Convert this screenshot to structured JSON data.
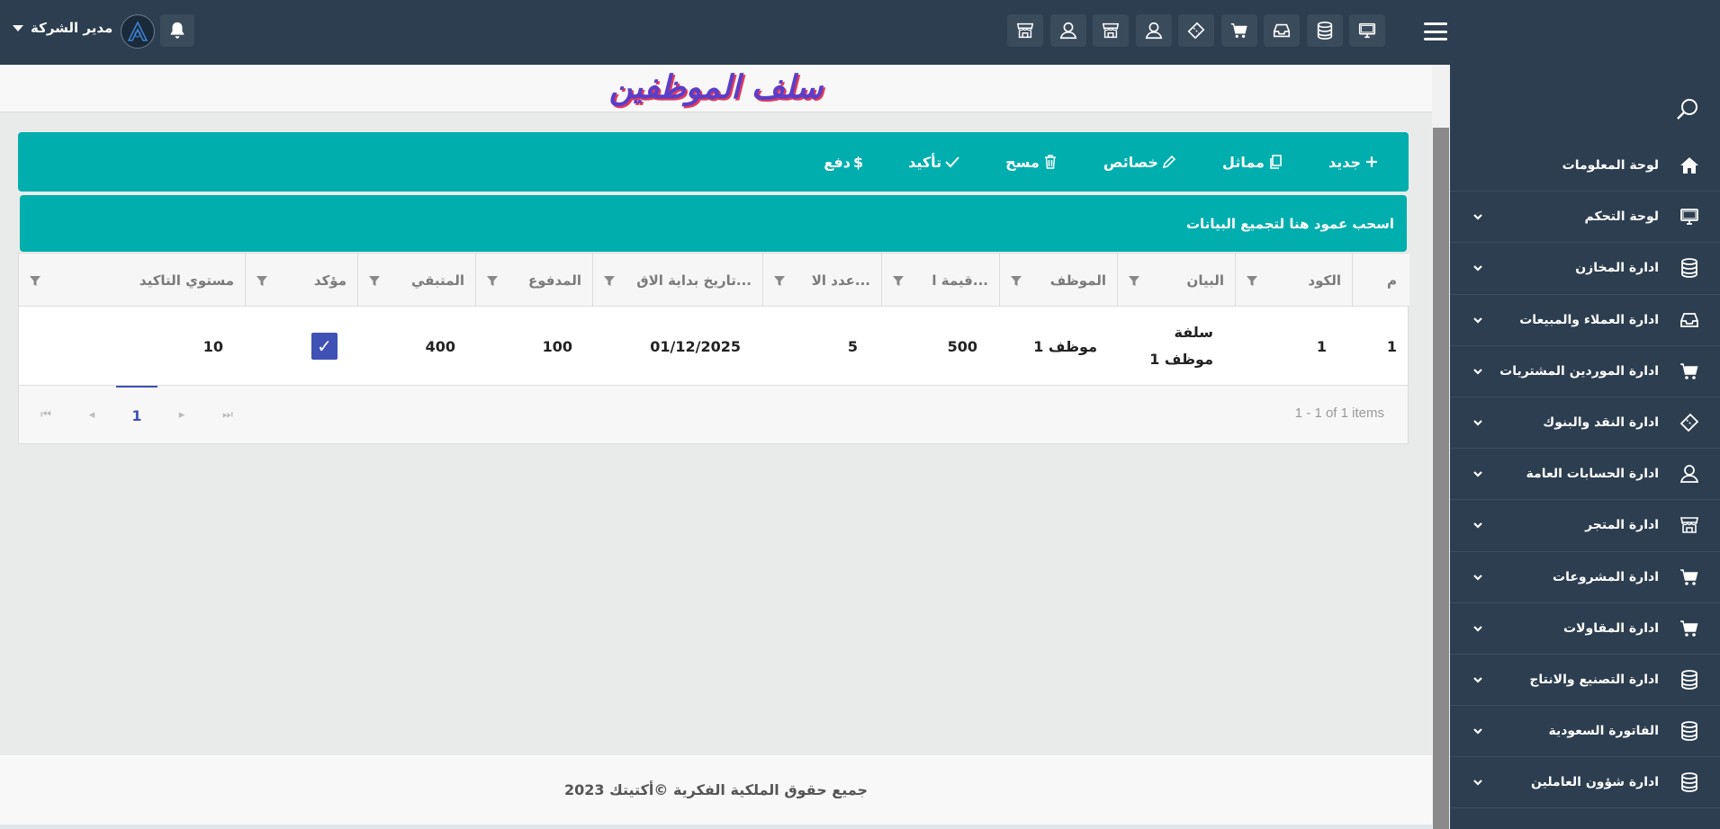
{
  "header": {
    "user_name": "مدير الشركة",
    "icons": [
      "monitor-icon",
      "database-icon",
      "inbox-icon",
      "cart-icon",
      "ticket-icon",
      "user-icon",
      "store-icon",
      "user-icon",
      "store-icon"
    ]
  },
  "sidebar": {
    "items": [
      {
        "label": "لوحة المعلومات",
        "icon": "home-icon",
        "has_children": false
      },
      {
        "label": "لوحة التحكم",
        "icon": "monitor-icon",
        "has_children": true
      },
      {
        "label": "ادارة المخازن",
        "icon": "database-icon",
        "has_children": true
      },
      {
        "label": "ادارة العملاء والمبيعات",
        "icon": "inbox-icon",
        "has_children": true
      },
      {
        "label": "ادارة الموردين المشتريات",
        "icon": "cart-icon",
        "has_children": true
      },
      {
        "label": "ادارة النقد والبنوك",
        "icon": "ticket-icon",
        "has_children": true
      },
      {
        "label": "ادارة الحسابات العامة",
        "icon": "user-icon",
        "has_children": true
      },
      {
        "label": "ادارة المتجر",
        "icon": "store-icon",
        "has_children": true
      },
      {
        "label": "ادارة المشروعات",
        "icon": "cart-icon",
        "has_children": true
      },
      {
        "label": "ادارة المقاولات",
        "icon": "cart-icon",
        "has_children": true
      },
      {
        "label": "ادارة التصنيع والانتاج",
        "icon": "database-icon",
        "has_children": true
      },
      {
        "label": "الفاتورة السعودية",
        "icon": "database-icon",
        "has_children": true
      },
      {
        "label": "ادارة شؤون العاملين",
        "icon": "database-icon",
        "has_children": true
      }
    ]
  },
  "page": {
    "title": "سلف الموظفين"
  },
  "toolbar": {
    "new_label": "جديد",
    "duplicate_label": "مماثل",
    "properties_label": "خصائص",
    "delete_label": "مسح",
    "confirm_label": "تأكيد",
    "pay_label": "دفع",
    "pay_symbol": "$"
  },
  "grid": {
    "group_hint": "اسحب عمود هنا لتجميع البيانات",
    "columns": [
      "م",
      "الكود",
      "البيان",
      "الموظف",
      "قيمة ا...",
      "عدد الا...",
      "تاريخ بداية الاق...",
      "المدفوع",
      "المتبقي",
      "مؤكد",
      "مستوي التاكيد"
    ],
    "rows": [
      {
        "index": "1",
        "code": "1",
        "description_line1": "سلفة",
        "description_line2": "موظف 1",
        "employee": "موظف 1",
        "amount": "500",
        "installments": "5",
        "start_date": "01/12/2025",
        "paid": "100",
        "remaining": "400",
        "confirmed": true,
        "confirm_level": "10"
      }
    ],
    "pager": {
      "current_page": "1",
      "info": "1 - 1 of 1 items"
    }
  },
  "footer": {
    "text": "جميع حقوق الملكية الفكرية ©أكتيتك 2023"
  },
  "colors": {
    "topbar": "#2c3e50",
    "accent": "#00aeae",
    "primary": "#3f51b5"
  }
}
